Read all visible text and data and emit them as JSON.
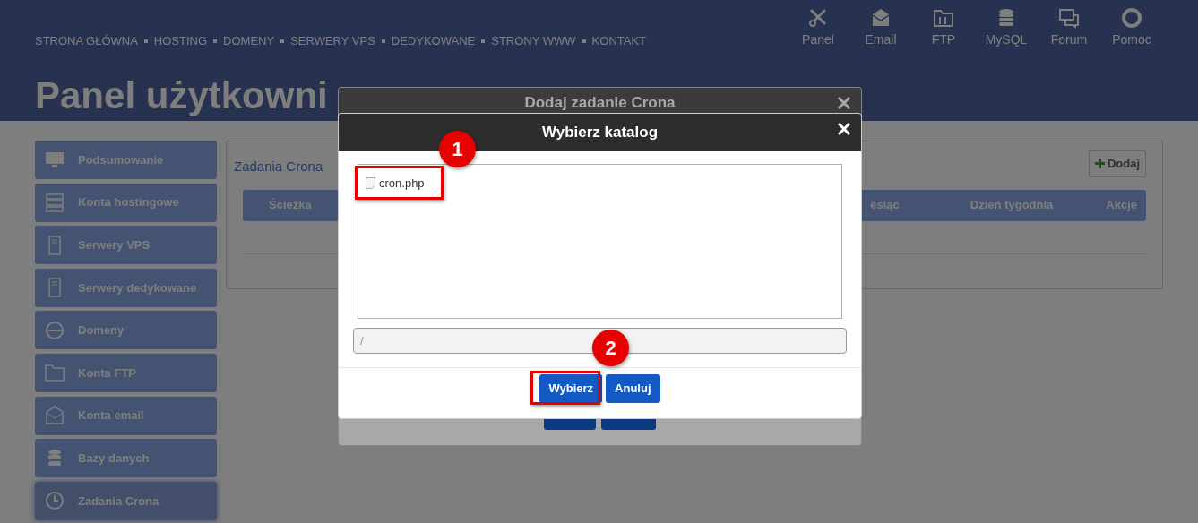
{
  "top_nav": {
    "links": [
      "STRONA GŁÓWNA",
      "HOSTING",
      "DOMENY",
      "SERWERY VPS",
      "DEDYKOWANE",
      "STRONY WWW",
      "KONTAKT"
    ]
  },
  "quick_links": [
    {
      "label": "Panel"
    },
    {
      "label": "Email"
    },
    {
      "label": "FTP"
    },
    {
      "label": "MySQL"
    },
    {
      "label": "Forum"
    },
    {
      "label": "Pomoc"
    }
  ],
  "page_title": "Panel użytkowni",
  "sidebar": {
    "items": [
      {
        "label": "Podsumowanie",
        "selected": false
      },
      {
        "label": "Konta hostingowe",
        "selected": false
      },
      {
        "label": "Serwery VPS",
        "selected": false
      },
      {
        "label": "Serwery dedykowane",
        "selected": false
      },
      {
        "label": "Domeny",
        "selected": false
      },
      {
        "label": "Konta FTP",
        "selected": false
      },
      {
        "label": "Konta email",
        "selected": false
      },
      {
        "label": "Bazy danych",
        "selected": false
      },
      {
        "label": "Zadania Crona",
        "selected": true
      }
    ]
  },
  "content": {
    "title": "Zadania Crona",
    "add_button": "Dodaj",
    "table": {
      "columns": [
        "Ścieżka",
        "esiąc",
        "Dzień tygodnia",
        "Akcje"
      ]
    }
  },
  "background_dialog": {
    "title": "Dodaj zadanie Crona"
  },
  "dialog": {
    "title": "Wybierz katalog",
    "files": [
      {
        "name": "cron.php"
      }
    ],
    "path": "/",
    "buttons": [
      {
        "label": "Wybierz"
      },
      {
        "label": "Anuluj"
      }
    ]
  },
  "annotations": [
    {
      "number": "1"
    },
    {
      "number": "2"
    }
  ]
}
